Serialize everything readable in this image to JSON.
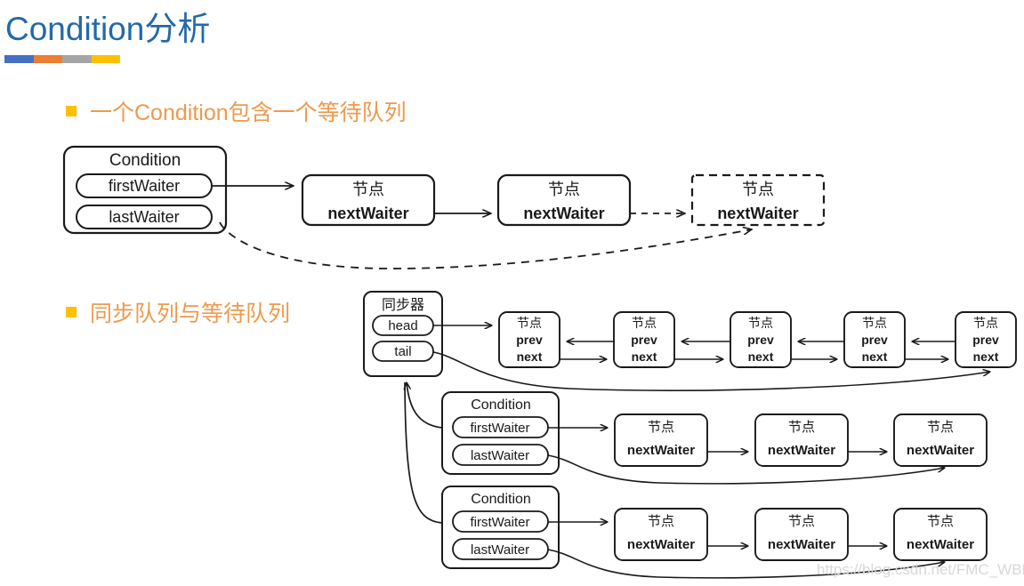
{
  "page": {
    "title": "Condition分析",
    "title_color": "#2269a8",
    "background": "#ffffff",
    "watermark": "https://blog.csdn.net/FMC_WBL"
  },
  "title_rule": {
    "colors": [
      "#4571c4",
      "#ed7d31",
      "#a5a5a5",
      "#ffc000"
    ]
  },
  "bullets": [
    {
      "marker": "square-bullet",
      "color": "#ffc000",
      "text": "一个Condition包含一个等待队列"
    },
    {
      "marker": "square-bullet",
      "color": "#ffc000",
      "text": "同步队列与等待队列"
    }
  ],
  "labels": {
    "condition": "Condition",
    "first_waiter": "firstWaiter",
    "last_waiter": "lastWaiter",
    "node": "节点",
    "next_waiter": "nextWaiter",
    "synchronizer": "同步器",
    "head": "head",
    "tail": "tail",
    "prev": "prev",
    "next": "next"
  },
  "diagram_top": {
    "condition_box": {
      "title": "Condition",
      "fields": [
        "firstWaiter",
        "lastWaiter"
      ]
    },
    "nodes": [
      {
        "title": "节点",
        "field": "nextWaiter",
        "border": "solid"
      },
      {
        "title": "节点",
        "field": "nextWaiter",
        "border": "solid"
      },
      {
        "title": "节点",
        "field": "nextWaiter",
        "border": "dashed"
      }
    ]
  },
  "diagram_bottom": {
    "sync_box": {
      "title": "同步器",
      "fields": [
        "head",
        "tail"
      ]
    },
    "sync_nodes": [
      {
        "title": "节点",
        "fields": [
          "prev",
          "next"
        ]
      },
      {
        "title": "节点",
        "fields": [
          "prev",
          "next"
        ]
      },
      {
        "title": "节点",
        "fields": [
          "prev",
          "next"
        ]
      },
      {
        "title": "节点",
        "fields": [
          "prev",
          "next"
        ]
      },
      {
        "title": "节点",
        "fields": [
          "prev",
          "next"
        ]
      }
    ],
    "conditions": [
      {
        "title": "Condition",
        "fields": [
          "firstWaiter",
          "lastWaiter"
        ],
        "nodes": [
          {
            "title": "节点",
            "field": "nextWaiter"
          },
          {
            "title": "节点",
            "field": "nextWaiter"
          },
          {
            "title": "节点",
            "field": "nextWaiter"
          }
        ]
      },
      {
        "title": "Condition",
        "fields": [
          "firstWaiter",
          "lastWaiter"
        ],
        "nodes": [
          {
            "title": "节点",
            "field": "nextWaiter"
          },
          {
            "title": "节点",
            "field": "nextWaiter"
          },
          {
            "title": "节点",
            "field": "nextWaiter"
          }
        ]
      }
    ]
  }
}
